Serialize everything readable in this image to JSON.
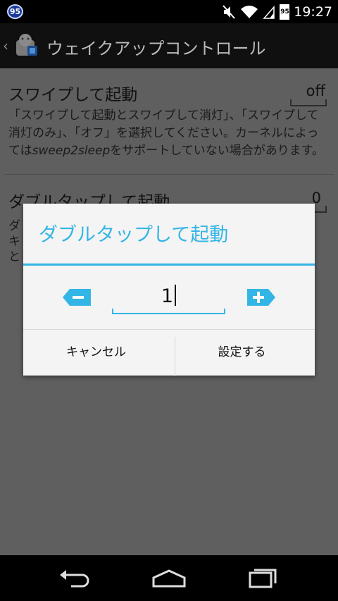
{
  "status_bar": {
    "notification_badge": "95",
    "battery_level": "95",
    "time": "19:27",
    "icons": [
      "volume-muted-icon",
      "wifi-icon",
      "signal-icon",
      "battery-icon"
    ]
  },
  "action_bar": {
    "title": "ウェイクアップコントロール",
    "icons": [
      "back-caret-icon",
      "app-logo-icon"
    ]
  },
  "preferences": [
    {
      "title": "スワイプして起動",
      "value": "off",
      "summary_parts": [
        "「スワイプして起動とスワイプして消灯」、「スワイプして消灯のみ」、「オフ」を選択してください。カーネルによっては",
        "sweep2sleep",
        "をサポートしていない場合があります。"
      ]
    },
    {
      "title": "ダブルタップして起動",
      "value": "0",
      "summary_fragments": [
        "ダ",
        "キ",
        "と"
      ]
    }
  ],
  "dialog": {
    "title": "ダブルタップして起動",
    "value": "1",
    "cancel_label": "キャンセル",
    "ok_label": "設定する"
  },
  "colors": {
    "accent": "#33b5e5",
    "overlay_background": "#5f5f5f",
    "dialog_background": "#f4f4f4"
  },
  "nav_bar": {
    "icons": [
      "back-icon",
      "home-icon",
      "recents-icon"
    ]
  }
}
